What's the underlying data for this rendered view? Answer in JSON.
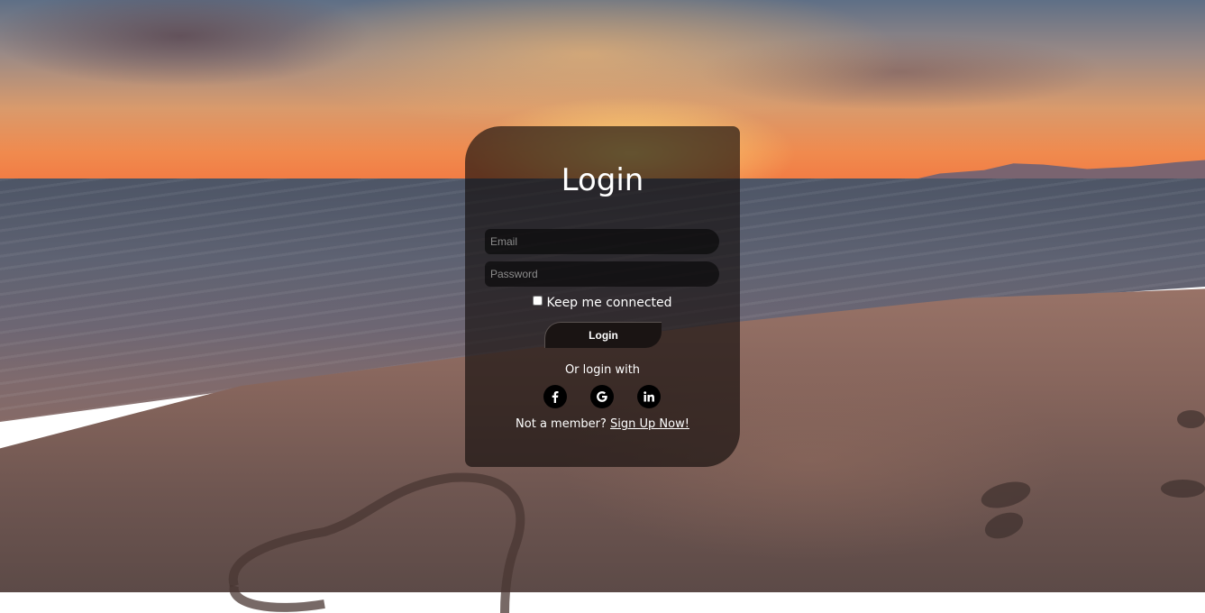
{
  "login_card": {
    "title": "Login",
    "email_placeholder": "Email",
    "password_placeholder": "Password",
    "remember_label": "Keep me connected",
    "login_button": "Login",
    "alt_login_text": "Or login with",
    "social_icons": [
      "facebook-icon",
      "google-icon",
      "linkedin-icon"
    ],
    "member_prompt": "Not a member?",
    "signup_link": "Sign Up Now!"
  },
  "colors": {
    "card_overlay": "#140e0c",
    "text": "#ffffff",
    "field_bg": "#000000",
    "social_bg": "#000000"
  }
}
